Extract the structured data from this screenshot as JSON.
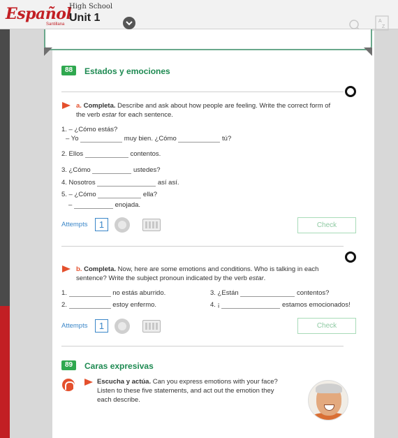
{
  "header": {
    "logo_text": "Español",
    "logo_sub": "Santillana",
    "grade": "High School",
    "unit": "Unit 1",
    "icons": [
      "chevron-down-icon",
      "search-icon",
      "az-icon"
    ]
  },
  "section88": {
    "number": "88",
    "title": "Estados y emociones"
  },
  "activity_a": {
    "label": "a.",
    "heading": "Completa.",
    "instruction_line1": "Describe and ask about how people are feeling. Write the correct form of",
    "instruction_line2_pre": "the verb ",
    "instruction_line2_em": "estar",
    "instruction_line2_post": " for each sentence.",
    "items": [
      {
        "pre": "1. – ¿Cómo estás?",
        "mid": "",
        "post": ""
      },
      {
        "pre": "– Yo",
        "mid": "muy bien. ¿Cómo",
        "post": "tú?"
      },
      {
        "pre": "2. Ellos",
        "mid": "contentos.",
        "post": ""
      },
      {
        "pre": "3. ¿Cómo",
        "mid": "ustedes?",
        "post": ""
      },
      {
        "pre": "4. Nosotros",
        "mid": "así así.",
        "post": ""
      },
      {
        "pre": "5. – ¿Cómo",
        "mid": "ella?",
        "post": ""
      },
      {
        "pre": "–",
        "mid": "enojada.",
        "post": ""
      }
    ],
    "attempts_label": "Attempts",
    "attempts": "1",
    "check": "Check"
  },
  "activity_b": {
    "label": "b.",
    "heading": "Completa.",
    "instruction_line1": "Now, here are some emotions and conditions. Who is talking in each",
    "instruction_line2_pre": "sentence? Write the subject pronoun indicated by the verb ",
    "instruction_line2_em": "estar",
    "instruction_line2_post": ".",
    "items": [
      {
        "num": "1.",
        "post": "no estás aburrido."
      },
      {
        "num": "2.",
        "post": "estoy enfermo."
      },
      {
        "num": "3. ¿Están",
        "post": "contentos?"
      },
      {
        "num": "4. ¡",
        "post": "estamos emocionados!"
      }
    ],
    "attempts_label": "Attempts",
    "attempts": "1",
    "check": "Check"
  },
  "section89": {
    "number": "89",
    "title": "Caras expresivas",
    "heading": "Escucha y actúa.",
    "instruction_line1": "Can you express emotions with your face?",
    "instruction_line2": "Listen to these five statements, and act out the emotion they",
    "instruction_line3": "each describe."
  },
  "colors": {
    "brand": "#c21f24",
    "accent_green": "#2fa84f",
    "activity_arrow": "#e4502d",
    "link_blue": "#3a86c8"
  }
}
